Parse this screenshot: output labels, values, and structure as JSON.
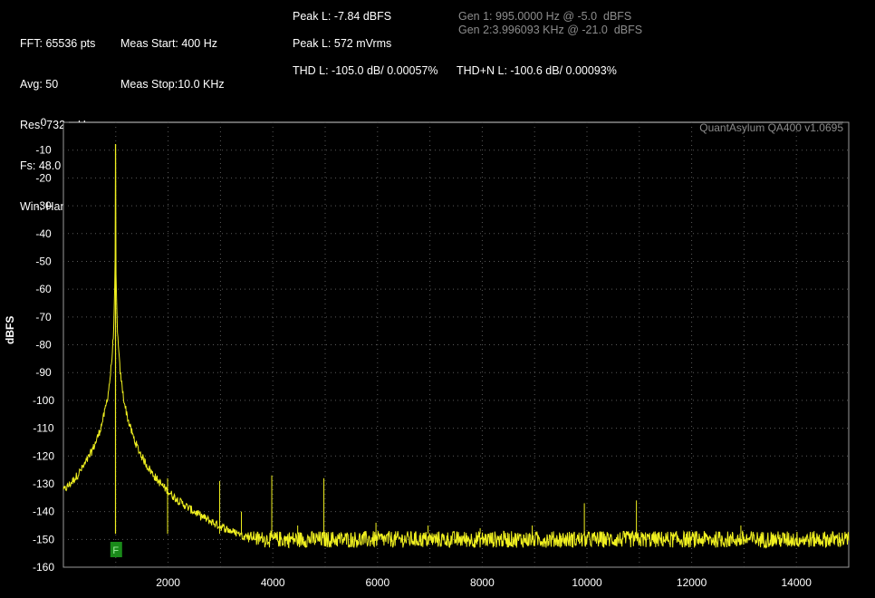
{
  "info": {
    "col1": [
      "FFT: 65536 pts",
      "Avg: 50",
      "Res: 732 mHz",
      "Fs: 48.0 KHz",
      "Win: Hann"
    ],
    "col2": [
      "Meas Start: 400 Hz",
      "Meas Stop:10.0 KHz"
    ],
    "peak_dbfs": "Peak L: -7.84 dBFS",
    "peak_rms": "Peak L: 572 mVrms",
    "thd": "THD L: -105.0 dB/ 0.00057%",
    "thdn": "THD+N L: -100.6 dB/ 0.00093%",
    "gen1": "Gen 1: 995.0000 Hz @ -5.0  dBFS",
    "gen2": "Gen 2:3.996093 KHz @ -21.0  dBFS"
  },
  "chart_data": {
    "type": "line",
    "ylabel": "dBFS",
    "watermark": "QuantAsylum QA400 v1.0695",
    "marker_label": "F",
    "marker_freq": 1000,
    "xlim": [
      0,
      15000
    ],
    "ylim": [
      -160,
      0
    ],
    "xticks": [
      2000,
      4000,
      6000,
      8000,
      10000,
      12000,
      14000
    ],
    "yticks": [
      0,
      -10,
      -20,
      -30,
      -40,
      -50,
      -60,
      -70,
      -80,
      -90,
      -100,
      -110,
      -120,
      -130,
      -140,
      -150,
      -160
    ],
    "grid": true,
    "colors": {
      "trace": "#f0f020",
      "grid": "#5a5a5a",
      "marker": "#1a8a1a"
    },
    "noise_floor": -150,
    "fundamental": {
      "freq": 995,
      "level": -7.84
    },
    "spurs": [
      {
        "freq": 1990,
        "level": -128
      },
      {
        "freq": 2985,
        "level": -129
      },
      {
        "freq": 3400,
        "level": -140
      },
      {
        "freq": 3980,
        "level": -127
      },
      {
        "freq": 4975,
        "level": -128
      },
      {
        "freq": 4475,
        "level": -145
      },
      {
        "freq": 5970,
        "level": -144
      },
      {
        "freq": 6965,
        "level": -145
      },
      {
        "freq": 7960,
        "level": -146
      },
      {
        "freq": 8955,
        "level": -145
      },
      {
        "freq": 9950,
        "level": -137
      },
      {
        "freq": 10945,
        "level": -136
      },
      {
        "freq": 12940,
        "level": -145
      }
    ]
  }
}
